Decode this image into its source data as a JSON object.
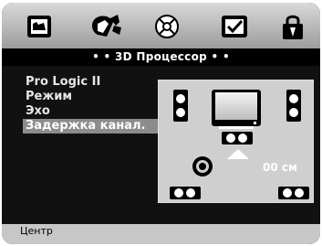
{
  "window": {
    "title": "• • 3D Процессор • •"
  },
  "tabs": [
    {
      "id": "tab-display",
      "icon": "display-icon",
      "active": false
    },
    {
      "id": "tab-audio",
      "icon": "speaker-icon",
      "active": true
    },
    {
      "id": "tab-misc",
      "icon": "disc-icon",
      "active": false
    },
    {
      "id": "tab-preferences",
      "icon": "checkbox-icon",
      "active": false
    },
    {
      "id": "tab-lock",
      "icon": "lock-icon",
      "active": false
    }
  ],
  "menu": {
    "items": [
      {
        "label": "Pro Logic II",
        "selected": false
      },
      {
        "label": "Режим",
        "selected": false
      },
      {
        "label": "Эхо",
        "selected": false
      },
      {
        "label": "Задержка канал.",
        "selected": true
      }
    ]
  },
  "layout_panel": {
    "selected_speaker": "center",
    "delay_value": "00 см"
  },
  "status": {
    "text": "Центр"
  },
  "colors": {
    "selected_item_bg": "#8c8c8c",
    "top_bar": "#b5b5b5",
    "bottom_bar": "#c7c7c7"
  }
}
